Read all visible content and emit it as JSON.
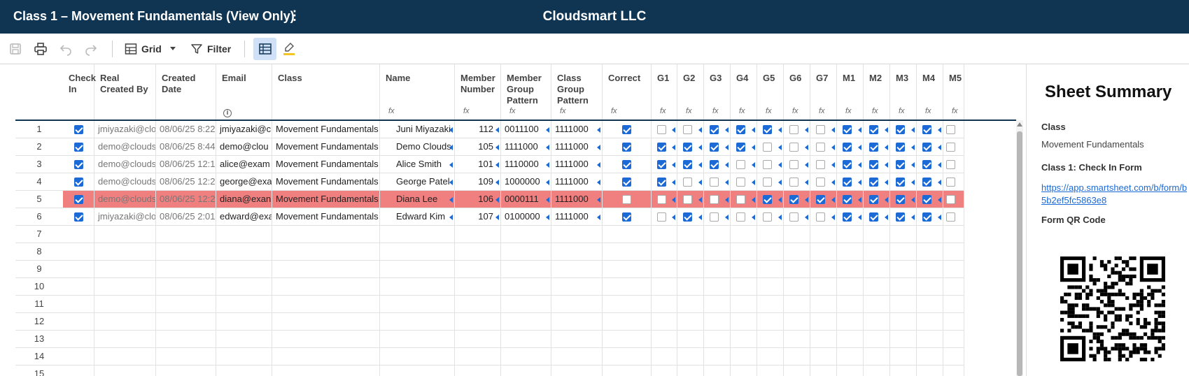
{
  "topbar": {
    "title": "Class 1 – Movement Fundamentals (View Only)",
    "menu_icon_glyph": "⋮",
    "company": "Cloudsmart LLC"
  },
  "toolbar": {
    "grid_label": "Grid",
    "filter_label": "Filter",
    "icons": [
      "save-icon",
      "print-icon",
      "undo-icon",
      "redo-icon",
      "grid-view-icon",
      "dropdown-caret-icon",
      "filter-icon",
      "sheet-view-icon",
      "highlight-changes-icon"
    ]
  },
  "columns": [
    {
      "key": "checkin",
      "label": "Check In",
      "formula": false
    },
    {
      "key": "created_by",
      "label": "Real Created By",
      "formula": false
    },
    {
      "key": "created_date",
      "label": "Created Date",
      "formula": false
    },
    {
      "key": "email",
      "label": "Email",
      "formula": false,
      "info": true
    },
    {
      "key": "class",
      "label": "Class",
      "formula": false
    },
    {
      "key": "name",
      "label": "Name",
      "formula": true
    },
    {
      "key": "member_number",
      "label": "Member Number",
      "formula": true
    },
    {
      "key": "member_group",
      "label": "Member Group Pattern",
      "formula": true
    },
    {
      "key": "class_group",
      "label": "Class Group Pattern",
      "formula": true
    },
    {
      "key": "correct",
      "label": "Correct",
      "formula": true
    },
    {
      "key": "g1",
      "label": "G1",
      "formula": true
    },
    {
      "key": "g2",
      "label": "G2",
      "formula": true
    },
    {
      "key": "g3",
      "label": "G3",
      "formula": true
    },
    {
      "key": "g4",
      "label": "G4",
      "formula": true
    },
    {
      "key": "g5",
      "label": "G5",
      "formula": true
    },
    {
      "key": "g6",
      "label": "G6",
      "formula": true
    },
    {
      "key": "g7",
      "label": "G7",
      "formula": true
    },
    {
      "key": "m1",
      "label": "M1",
      "formula": true
    },
    {
      "key": "m2",
      "label": "M2",
      "formula": true
    },
    {
      "key": "m3",
      "label": "M3",
      "formula": true
    },
    {
      "key": "m4",
      "label": "M4",
      "formula": true
    },
    {
      "key": "m5",
      "label": "M5",
      "formula": true
    }
  ],
  "formula_glyph": "fx",
  "info_glyph": "i",
  "rows": [
    {
      "num": "1",
      "checkin": true,
      "created_by": "jmiyazaki@clo",
      "created_date": "08/06/25 8:22",
      "email": "jmiyazaki@c",
      "class": "Movement Fundamentals",
      "name": "Juni Miyazaki",
      "member_number": "112",
      "member_group": "0011100",
      "class_group": "1111000",
      "correct": true,
      "g": [
        false,
        false,
        true,
        true,
        true,
        false,
        false
      ],
      "m": [
        true,
        true,
        true,
        true,
        false
      ],
      "highlight": false
    },
    {
      "num": "2",
      "checkin": true,
      "created_by": "demo@clouds",
      "created_date": "08/06/25 8:44",
      "email": "demo@clou",
      "class": "Movement Fundamentals",
      "name": "Demo Clouds",
      "member_number": "105",
      "member_group": "1111000",
      "class_group": "1111000",
      "correct": true,
      "g": [
        true,
        true,
        true,
        true,
        false,
        false,
        false
      ],
      "m": [
        true,
        true,
        true,
        true,
        false
      ],
      "highlight": false
    },
    {
      "num": "3",
      "checkin": true,
      "created_by": "demo@clouds",
      "created_date": "08/06/25 12:1",
      "email": "alice@exam",
      "class": "Movement Fundamentals",
      "name": "Alice Smith",
      "member_number": "101",
      "member_group": "1110000",
      "class_group": "1111000",
      "correct": true,
      "g": [
        true,
        true,
        true,
        false,
        false,
        false,
        false
      ],
      "m": [
        true,
        true,
        true,
        true,
        false
      ],
      "highlight": false
    },
    {
      "num": "4",
      "checkin": true,
      "created_by": "demo@clouds",
      "created_date": "08/06/25 12:2",
      "email": "george@exa",
      "class": "Movement Fundamentals",
      "name": "George Patel",
      "member_number": "109",
      "member_group": "1000000",
      "class_group": "1111000",
      "correct": true,
      "g": [
        true,
        false,
        false,
        false,
        false,
        false,
        false
      ],
      "m": [
        true,
        true,
        true,
        true,
        false
      ],
      "highlight": false
    },
    {
      "num": "5",
      "checkin": true,
      "created_by": "demo@clouds",
      "created_date": "08/06/25 12:2",
      "email": "diana@exan",
      "class": "Movement Fundamentals",
      "name": "Diana Lee",
      "member_number": "106",
      "member_group": "0000111",
      "class_group": "1111000",
      "correct": false,
      "g": [
        false,
        false,
        false,
        false,
        true,
        true,
        true
      ],
      "m": [
        true,
        true,
        true,
        true,
        false
      ],
      "highlight": true
    },
    {
      "num": "6",
      "checkin": true,
      "created_by": "jmiyazaki@clo",
      "created_date": "08/06/25 2:01",
      "email": "edward@exa",
      "class": "Movement Fundamentals",
      "name": "Edward Kim",
      "member_number": "107",
      "member_group": "0100000",
      "class_group": "1111000",
      "correct": true,
      "g": [
        false,
        true,
        false,
        false,
        false,
        false,
        false
      ],
      "m": [
        true,
        true,
        true,
        true,
        false
      ],
      "highlight": false
    }
  ],
  "empty_rows": [
    "7",
    "8",
    "9",
    "10",
    "11",
    "12",
    "13",
    "14",
    "15"
  ],
  "summary": {
    "title": "Sheet Summary",
    "class_label": "Class",
    "class_value": "Movement Fundamentals",
    "form_label": "Class 1: Check In Form",
    "form_link": "https://app.smartsheet.com/b/form/b5b2ef5fc5863e8",
    "qr_label": "Form QR Code"
  },
  "colors": {
    "topbar": "#0f3553",
    "accent": "#1c6ad6",
    "highlight_row": "#f08080"
  }
}
